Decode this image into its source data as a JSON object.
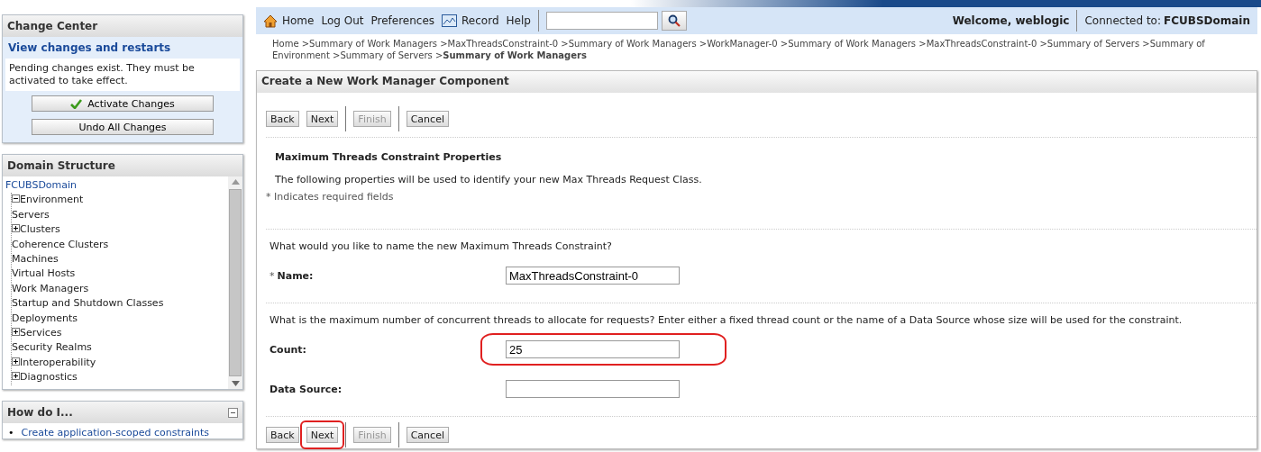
{
  "change_center": {
    "title": "Change Center",
    "link": "View changes and restarts",
    "message": "Pending changes exist. They must be activated to take effect.",
    "buttons": [
      {
        "label": "Activate Changes",
        "kind": "activate"
      },
      {
        "label": "Undo All Changes",
        "kind": "plain"
      }
    ]
  },
  "domain_structure": {
    "title": "Domain Structure",
    "tree": [
      {
        "label": "FCUBSDomain",
        "children": [
          {
            "label": "Environment",
            "expanded": true,
            "children": [
              {
                "label": "Servers"
              },
              {
                "label": "Clusters",
                "expanded": false
              },
              {
                "label": "Coherence Clusters"
              },
              {
                "label": "Machines"
              },
              {
                "label": "Virtual Hosts"
              },
              {
                "label": "Work Managers"
              },
              {
                "label": "Startup and Shutdown Classes"
              }
            ]
          },
          {
            "label": "Deployments"
          },
          {
            "label": "Services",
            "expanded": false
          },
          {
            "label": "Security Realms"
          },
          {
            "label": "Interoperability",
            "expanded": false
          },
          {
            "label": "Diagnostics",
            "expanded": false
          }
        ]
      }
    ]
  },
  "how_do_i": {
    "title": "How do I...",
    "items": [
      {
        "marker": "•",
        "label": "Create application-scoped constraints"
      }
    ]
  },
  "toolbar": {
    "links": [
      {
        "label": "Home",
        "kind": "home"
      },
      {
        "label": "Log Out",
        "kind": "text"
      },
      {
        "label": "Preferences",
        "kind": "text"
      },
      {
        "label": "Record",
        "kind": "record"
      },
      {
        "label": "Help",
        "kind": "text"
      }
    ],
    "welcome": "Welcome, weblogic",
    "connected_label": "Connected to:",
    "domain": "FCUBSDomain"
  },
  "breadcrumb": "Home >Summary of Work Managers >MaxThreadsConstraint-0 >Summary of Work Managers >WorkManager-0 >Summary of Work Managers >MaxThreadsConstraint-0 >Summary of Servers >Summary of Environment >Summary of Servers >**Summary of Work Managers**",
  "panel": {
    "title": "Create a New Work Manager Component",
    "buttons": [
      {
        "kind": "button",
        "label": "Back",
        "disabled": false,
        "highlighted": false
      },
      {
        "kind": "button",
        "label": "Next",
        "disabled": false,
        "highlighted": false
      },
      {
        "kind": "separator"
      },
      {
        "kind": "button",
        "label": "Finish",
        "disabled": true,
        "highlighted": false
      },
      {
        "kind": "separator"
      },
      {
        "kind": "button",
        "label": "Cancel",
        "disabled": false,
        "highlighted": false
      }
    ],
    "section_title": "Maximum Threads Constraint Properties",
    "intro": "The following properties will be used to identify your new Max Threads Request Class.",
    "required_note": "* Indicates required fields",
    "questions": [
      {
        "text": "What would you like to name the new Maximum Threads Constraint?",
        "fields": [
          {
            "label": "Name:",
            "required_mark": "*",
            "value": "MaxThreadsConstraint-0",
            "highlighted": false
          }
        ]
      },
      {
        "text": "What is the maximum number of concurrent threads to allocate for requests? Enter either a fixed thread count or the name of a Data Source whose size will be used for the constraint.",
        "fields": [
          {
            "label": "Count:",
            "value": "25",
            "highlighted": true
          },
          {
            "label": "Data Source:",
            "highlighted": false
          }
        ]
      }
    ],
    "bottom_buttons": [
      {
        "kind": "button",
        "label": "Back",
        "disabled": false,
        "highlighted": false
      },
      {
        "kind": "button",
        "label": "Next",
        "disabled": false,
        "highlighted": true
      },
      {
        "kind": "separator"
      },
      {
        "kind": "button",
        "label": "Finish",
        "disabled": true,
        "highlighted": false
      },
      {
        "kind": "separator"
      },
      {
        "kind": "button",
        "label": "Cancel",
        "disabled": false,
        "highlighted": false
      }
    ]
  }
}
